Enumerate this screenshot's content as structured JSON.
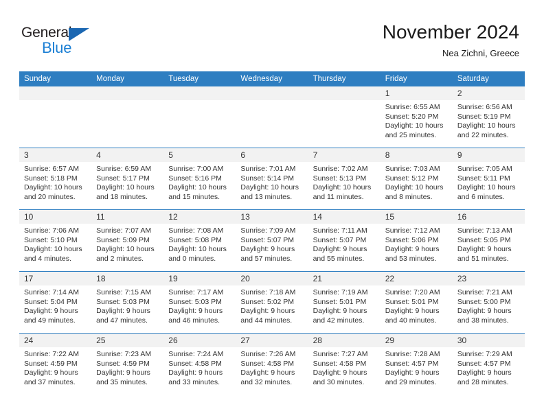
{
  "logo": {
    "word_top": "General",
    "word_bottom": "Blue",
    "triangle_color": "#1b67b2",
    "blue_color": "#1b7fd4",
    "dark_color": "#231f20"
  },
  "header": {
    "title": "November 2024",
    "subtitle": "Nea Zichni, Greece"
  },
  "theme": {
    "header_bg": "#2e7ec1",
    "daynum_bg": "#f2f2f2",
    "grid_line": "#2e7ec1",
    "text": "#333333"
  },
  "columns": [
    "Sunday",
    "Monday",
    "Tuesday",
    "Wednesday",
    "Thursday",
    "Friday",
    "Saturday"
  ],
  "weeks": [
    [
      {
        "day": "",
        "empty": true
      },
      {
        "day": "",
        "empty": true
      },
      {
        "day": "",
        "empty": true
      },
      {
        "day": "",
        "empty": true
      },
      {
        "day": "",
        "empty": true
      },
      {
        "day": "1",
        "sunrise": "Sunrise: 6:55 AM",
        "sunset": "Sunset: 5:20 PM",
        "daylight": "Daylight: 10 hours and 25 minutes."
      },
      {
        "day": "2",
        "sunrise": "Sunrise: 6:56 AM",
        "sunset": "Sunset: 5:19 PM",
        "daylight": "Daylight: 10 hours and 22 minutes."
      }
    ],
    [
      {
        "day": "3",
        "sunrise": "Sunrise: 6:57 AM",
        "sunset": "Sunset: 5:18 PM",
        "daylight": "Daylight: 10 hours and 20 minutes."
      },
      {
        "day": "4",
        "sunrise": "Sunrise: 6:59 AM",
        "sunset": "Sunset: 5:17 PM",
        "daylight": "Daylight: 10 hours and 18 minutes."
      },
      {
        "day": "5",
        "sunrise": "Sunrise: 7:00 AM",
        "sunset": "Sunset: 5:16 PM",
        "daylight": "Daylight: 10 hours and 15 minutes."
      },
      {
        "day": "6",
        "sunrise": "Sunrise: 7:01 AM",
        "sunset": "Sunset: 5:14 PM",
        "daylight": "Daylight: 10 hours and 13 minutes."
      },
      {
        "day": "7",
        "sunrise": "Sunrise: 7:02 AM",
        "sunset": "Sunset: 5:13 PM",
        "daylight": "Daylight: 10 hours and 11 minutes."
      },
      {
        "day": "8",
        "sunrise": "Sunrise: 7:03 AM",
        "sunset": "Sunset: 5:12 PM",
        "daylight": "Daylight: 10 hours and 8 minutes."
      },
      {
        "day": "9",
        "sunrise": "Sunrise: 7:05 AM",
        "sunset": "Sunset: 5:11 PM",
        "daylight": "Daylight: 10 hours and 6 minutes."
      }
    ],
    [
      {
        "day": "10",
        "sunrise": "Sunrise: 7:06 AM",
        "sunset": "Sunset: 5:10 PM",
        "daylight": "Daylight: 10 hours and 4 minutes."
      },
      {
        "day": "11",
        "sunrise": "Sunrise: 7:07 AM",
        "sunset": "Sunset: 5:09 PM",
        "daylight": "Daylight: 10 hours and 2 minutes."
      },
      {
        "day": "12",
        "sunrise": "Sunrise: 7:08 AM",
        "sunset": "Sunset: 5:08 PM",
        "daylight": "Daylight: 10 hours and 0 minutes."
      },
      {
        "day": "13",
        "sunrise": "Sunrise: 7:09 AM",
        "sunset": "Sunset: 5:07 PM",
        "daylight": "Daylight: 9 hours and 57 minutes."
      },
      {
        "day": "14",
        "sunrise": "Sunrise: 7:11 AM",
        "sunset": "Sunset: 5:07 PM",
        "daylight": "Daylight: 9 hours and 55 minutes."
      },
      {
        "day": "15",
        "sunrise": "Sunrise: 7:12 AM",
        "sunset": "Sunset: 5:06 PM",
        "daylight": "Daylight: 9 hours and 53 minutes."
      },
      {
        "day": "16",
        "sunrise": "Sunrise: 7:13 AM",
        "sunset": "Sunset: 5:05 PM",
        "daylight": "Daylight: 9 hours and 51 minutes."
      }
    ],
    [
      {
        "day": "17",
        "sunrise": "Sunrise: 7:14 AM",
        "sunset": "Sunset: 5:04 PM",
        "daylight": "Daylight: 9 hours and 49 minutes."
      },
      {
        "day": "18",
        "sunrise": "Sunrise: 7:15 AM",
        "sunset": "Sunset: 5:03 PM",
        "daylight": "Daylight: 9 hours and 47 minutes."
      },
      {
        "day": "19",
        "sunrise": "Sunrise: 7:17 AM",
        "sunset": "Sunset: 5:03 PM",
        "daylight": "Daylight: 9 hours and 46 minutes."
      },
      {
        "day": "20",
        "sunrise": "Sunrise: 7:18 AM",
        "sunset": "Sunset: 5:02 PM",
        "daylight": "Daylight: 9 hours and 44 minutes."
      },
      {
        "day": "21",
        "sunrise": "Sunrise: 7:19 AM",
        "sunset": "Sunset: 5:01 PM",
        "daylight": "Daylight: 9 hours and 42 minutes."
      },
      {
        "day": "22",
        "sunrise": "Sunrise: 7:20 AM",
        "sunset": "Sunset: 5:01 PM",
        "daylight": "Daylight: 9 hours and 40 minutes."
      },
      {
        "day": "23",
        "sunrise": "Sunrise: 7:21 AM",
        "sunset": "Sunset: 5:00 PM",
        "daylight": "Daylight: 9 hours and 38 minutes."
      }
    ],
    [
      {
        "day": "24",
        "sunrise": "Sunrise: 7:22 AM",
        "sunset": "Sunset: 4:59 PM",
        "daylight": "Daylight: 9 hours and 37 minutes."
      },
      {
        "day": "25",
        "sunrise": "Sunrise: 7:23 AM",
        "sunset": "Sunset: 4:59 PM",
        "daylight": "Daylight: 9 hours and 35 minutes."
      },
      {
        "day": "26",
        "sunrise": "Sunrise: 7:24 AM",
        "sunset": "Sunset: 4:58 PM",
        "daylight": "Daylight: 9 hours and 33 minutes."
      },
      {
        "day": "27",
        "sunrise": "Sunrise: 7:26 AM",
        "sunset": "Sunset: 4:58 PM",
        "daylight": "Daylight: 9 hours and 32 minutes."
      },
      {
        "day": "28",
        "sunrise": "Sunrise: 7:27 AM",
        "sunset": "Sunset: 4:58 PM",
        "daylight": "Daylight: 9 hours and 30 minutes."
      },
      {
        "day": "29",
        "sunrise": "Sunrise: 7:28 AM",
        "sunset": "Sunset: 4:57 PM",
        "daylight": "Daylight: 9 hours and 29 minutes."
      },
      {
        "day": "30",
        "sunrise": "Sunrise: 7:29 AM",
        "sunset": "Sunset: 4:57 PM",
        "daylight": "Daylight: 9 hours and 28 minutes."
      }
    ]
  ]
}
